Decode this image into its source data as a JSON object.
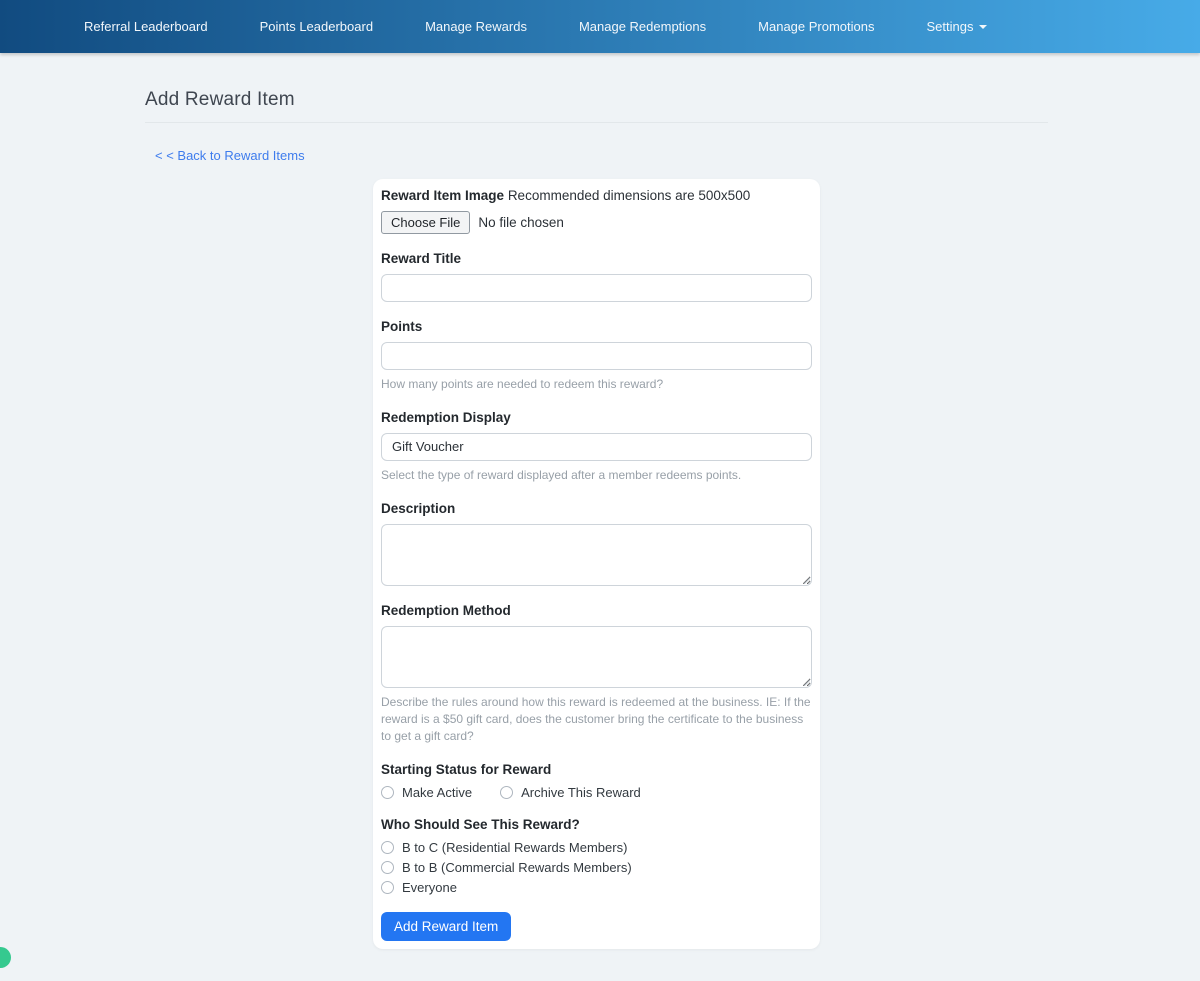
{
  "navbar": {
    "items": [
      {
        "label": "Referral Leaderboard"
      },
      {
        "label": "Points Leaderboard"
      },
      {
        "label": "Manage Rewards"
      },
      {
        "label": "Manage Redemptions"
      },
      {
        "label": "Manage Promotions"
      },
      {
        "label": "Settings"
      }
    ]
  },
  "page": {
    "title": "Add Reward Item",
    "back_link": "< < Back to Reward Items"
  },
  "form": {
    "image_field": {
      "label": "Reward Item Image",
      "hint": "Recommended dimensions are 500x500",
      "choose_file_label": "Choose File",
      "no_file_text": "No file chosen"
    },
    "reward_title": {
      "label": "Reward Title",
      "value": ""
    },
    "points": {
      "label": "Points",
      "value": "",
      "help": "How many points are needed to redeem this reward?"
    },
    "redemption_display": {
      "label": "Redemption Display",
      "value": "Gift Voucher",
      "help": "Select the type of reward displayed after a member redeems points."
    },
    "description": {
      "label": "Description",
      "value": ""
    },
    "redemption_method": {
      "label": "Redemption Method",
      "value": "",
      "help": "Describe the rules around how this reward is redeemed at the business. IE: If the reward is a $50 gift card, does the customer bring the certificate to the business to get a gift card?"
    },
    "starting_status": {
      "label": "Starting Status for Reward",
      "options": [
        {
          "label": "Make Active",
          "checked": false
        },
        {
          "label": "Archive This Reward",
          "checked": false
        }
      ]
    },
    "audience": {
      "label": "Who Should See This Reward?",
      "options": [
        {
          "label": "B to C (Residential Rewards Members)",
          "checked": false
        },
        {
          "label": "B to B (Commercial Rewards Members)",
          "checked": false
        },
        {
          "label": "Everyone",
          "checked": false
        }
      ]
    },
    "submit_label": "Add Reward Item"
  },
  "colors": {
    "navbar_gradient_start": "#114b80",
    "navbar_gradient_end": "#47abe8",
    "link_blue": "#3e7ced",
    "button_blue": "#2376f2",
    "chat_bubble_green": "#35c98f",
    "page_background": "#eff3f6"
  }
}
